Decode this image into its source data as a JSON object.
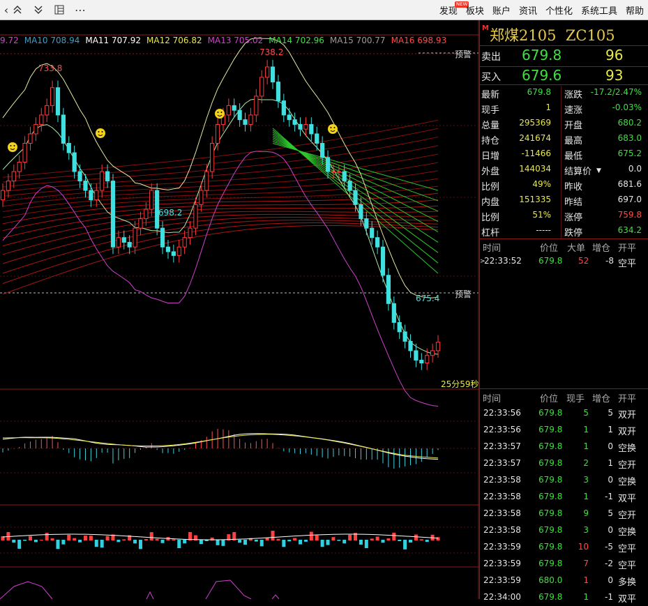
{
  "toolbar": {
    "menu": [
      {
        "label": "发现",
        "badge": "NEW"
      },
      {
        "label": "板块"
      },
      {
        "label": "账户"
      },
      {
        "label": "资讯"
      },
      {
        "label": "个性化"
      },
      {
        "label": "系统工具"
      },
      {
        "label": "帮助"
      }
    ]
  },
  "ma_legend": [
    {
      "label": "9.72",
      "color": "#cc44cc"
    },
    {
      "label": "MA10 708.94",
      "color": "#3aa0c8"
    },
    {
      "label": "MA11 707.92",
      "color": "#ffffff"
    },
    {
      "label": "MA12 706.82",
      "color": "#e8e84a"
    },
    {
      "label": "MA13 705.02",
      "color": "#d040d0"
    },
    {
      "label": "MA14 702.96",
      "color": "#3fe03f"
    },
    {
      "label": "MA15 700.77",
      "color": "#9a9a9a"
    },
    {
      "label": "MA16 698.93",
      "color": "#ff4a4a"
    }
  ],
  "chart_labels": {
    "high_1": "733.8",
    "high_2": "738.2",
    "low_1": "698.2",
    "low_2": "675.4",
    "warn_top": "预警",
    "warn_bottom": "预警",
    "countdown": "25分59秒"
  },
  "chart_data": {
    "type": "candlestick",
    "price_range": [
      670,
      745
    ],
    "annotations": {
      "high": 738.2,
      "low": 675.4,
      "local_high": 733.8,
      "local_low": 698.2
    },
    "close_path": [
      712,
      714,
      716,
      718,
      722,
      724,
      726,
      728,
      730,
      733.8,
      728,
      722,
      720,
      716,
      714,
      712,
      710,
      712,
      716,
      714,
      700,
      702,
      701,
      700,
      704,
      706,
      708,
      712,
      704,
      700,
      699,
      698.2,
      700,
      702,
      704,
      709,
      712,
      716,
      722,
      726,
      728,
      730,
      729,
      727,
      726,
      728,
      732,
      736,
      738.2,
      735,
      731,
      728,
      727,
      726,
      725,
      726,
      724,
      722,
      719,
      716,
      716,
      716,
      714,
      712,
      709,
      706,
      704,
      702,
      700,
      694,
      688,
      684,
      682,
      680,
      678,
      676,
      675.4,
      677,
      678,
      679.8
    ]
  },
  "quote": {
    "market_tag": "M",
    "name": "郑煤2105",
    "code": "ZC105",
    "sell_label": "卖出",
    "sell_price": "679.8",
    "sell_vol": "96",
    "buy_label": "买入",
    "buy_price": "679.6",
    "buy_vol": "93",
    "stats": [
      {
        "l1": "最新",
        "v1": "679.8",
        "c1": "grn",
        "l2": "涨跌",
        "v2": "-17.2/2.47%",
        "c2": "grn"
      },
      {
        "l1": "现手",
        "v1": "1",
        "c1": "yel",
        "l2": "速涨",
        "v2": "-0.03%",
        "c2": "grn"
      },
      {
        "l1": "总量",
        "v1": "295369",
        "c1": "yel",
        "l2": "开盘",
        "v2": "680.2",
        "c2": "grn"
      },
      {
        "l1": "持仓",
        "v1": "241674",
        "c1": "yel",
        "l2": "最高",
        "v2": "683.0",
        "c2": "grn"
      },
      {
        "l1": "日增",
        "v1": "-11466",
        "c1": "yel",
        "l2": "最低",
        "v2": "675.2",
        "c2": "grn"
      },
      {
        "l1": "外盘",
        "v1": "144034",
        "c1": "yel",
        "l2": "结算价",
        "v2": "0.0",
        "c2": "wht"
      },
      {
        "l1": "比例",
        "v1": "49%",
        "c1": "yel",
        "l2": "昨收",
        "v2": "681.6",
        "c2": "wht"
      },
      {
        "l1": "内盘",
        "v1": "151335",
        "c1": "yel",
        "l2": "昨结",
        "v2": "697.0",
        "c2": "wht"
      },
      {
        "l1": "比例",
        "v1": "51%",
        "c1": "yel",
        "l2": "涨停",
        "v2": "759.8",
        "c2": "red"
      },
      {
        "l1": "杠杆",
        "v1": "-----",
        "c1": "wht",
        "l2": "跌停",
        "v2": "634.2",
        "c2": "grn"
      }
    ],
    "big_header": {
      "time": "时间",
      "price": "价位",
      "vol": "大单",
      "chg": "增仓",
      "type": "开平"
    },
    "big_trades": [
      {
        "time": "22:33:52",
        "price": "679.8",
        "vol": "52",
        "chg": "-8",
        "type": "空平"
      }
    ]
  },
  "ticks": {
    "header": {
      "time": "时间",
      "price": "价位",
      "vol": "现手",
      "chg": "增仓",
      "type": "开平"
    },
    "rows": [
      {
        "time": "22:33:56",
        "price": "679.8",
        "vol": "5",
        "vc": "grn",
        "chg": "5",
        "type": "双开"
      },
      {
        "time": "22:33:56",
        "price": "679.8",
        "vol": "1",
        "vc": "grn",
        "chg": "1",
        "type": "双开"
      },
      {
        "time": "22:33:57",
        "price": "679.8",
        "vol": "1",
        "vc": "grn",
        "chg": "0",
        "type": "空换"
      },
      {
        "time": "22:33:57",
        "price": "679.8",
        "vol": "2",
        "vc": "grn",
        "chg": "1",
        "type": "空开"
      },
      {
        "time": "22:33:58",
        "price": "679.8",
        "vol": "3",
        "vc": "grn",
        "chg": "0",
        "type": "空换"
      },
      {
        "time": "22:33:58",
        "price": "679.8",
        "vol": "1",
        "vc": "grn",
        "chg": "-1",
        "type": "双平"
      },
      {
        "time": "22:33:58",
        "price": "679.8",
        "vol": "9",
        "vc": "grn",
        "chg": "5",
        "type": "空开"
      },
      {
        "time": "22:33:58",
        "price": "679.8",
        "vol": "3",
        "vc": "grn",
        "chg": "0",
        "type": "空换"
      },
      {
        "time": "22:33:59",
        "price": "679.8",
        "vol": "10",
        "vc": "red",
        "chg": "-5",
        "type": "空平"
      },
      {
        "time": "22:33:59",
        "price": "679.8",
        "vol": "7",
        "vc": "red",
        "chg": "-2",
        "type": "空平"
      },
      {
        "time": "22:33:59",
        "price": "680.0",
        "vol": "1",
        "vc": "red",
        "chg": "0",
        "type": "多换"
      },
      {
        "time": "22:34:00",
        "price": "679.8",
        "vol": "1",
        "vc": "grn",
        "chg": "-1",
        "type": "双平"
      }
    ]
  }
}
